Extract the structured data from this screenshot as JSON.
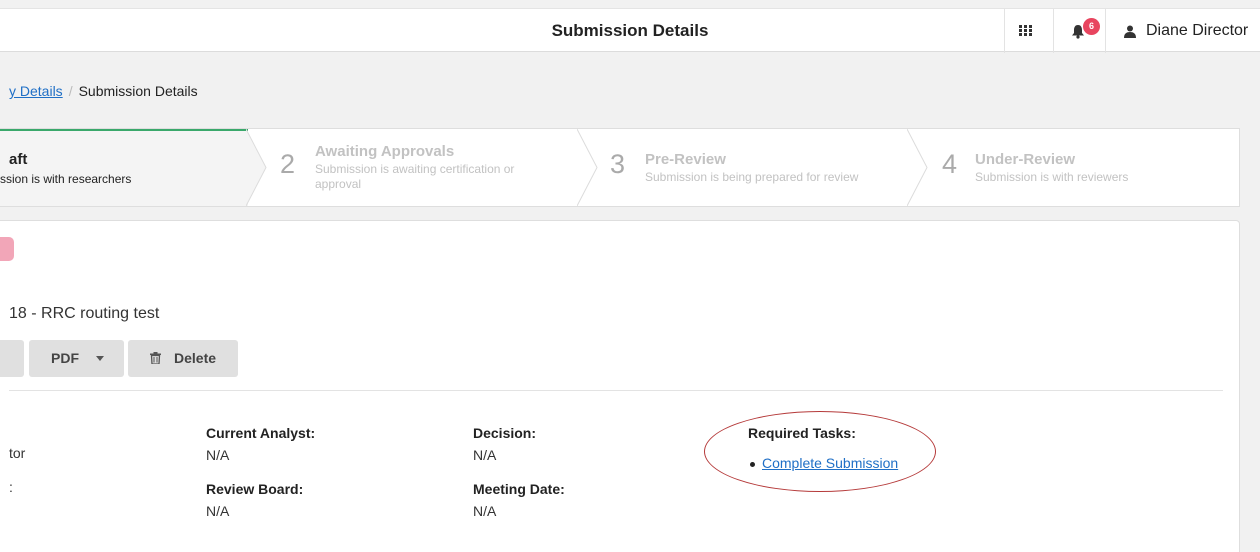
{
  "header": {
    "title": "Submission Details",
    "notification_count": "6",
    "user_name": "Diane Director"
  },
  "breadcrumb": {
    "parent_label": "y Details",
    "separator": "/",
    "current_label": "Submission Details"
  },
  "steps": [
    {
      "number": "",
      "title": "aft",
      "description": "ssion is with researchers",
      "active": true
    },
    {
      "number": "2",
      "title": "Awaiting Approvals",
      "description": "Submission is awaiting certification or approval",
      "active": false
    },
    {
      "number": "3",
      "title": "Pre-Review",
      "description": "Submission is being prepared for review",
      "active": false
    },
    {
      "number": "4",
      "title": "Under-Review",
      "description": "Submission is with reviewers",
      "active": false
    }
  ],
  "submission": {
    "title": "18 - RRC routing test"
  },
  "toolbar": {
    "pdf_label": "PDF",
    "delete_label": "Delete"
  },
  "details": {
    "left_fragment_1": "tor",
    "left_fragment_2": ":",
    "current_analyst": {
      "label": "Current Analyst:",
      "value": "N/A"
    },
    "review_board": {
      "label": "Review Board:",
      "value": "N/A"
    },
    "decision": {
      "label": "Decision:",
      "value": "N/A"
    },
    "meeting_date": {
      "label": "Meeting Date:",
      "value": "N/A"
    }
  },
  "required_tasks": {
    "label": "Required Tasks:",
    "items": [
      "Complete Submission"
    ]
  },
  "colors": {
    "active_step_border": "#3aa86b",
    "link": "#1f6fc6",
    "badge": "#e8455f",
    "annotation": "#b53a3a"
  }
}
